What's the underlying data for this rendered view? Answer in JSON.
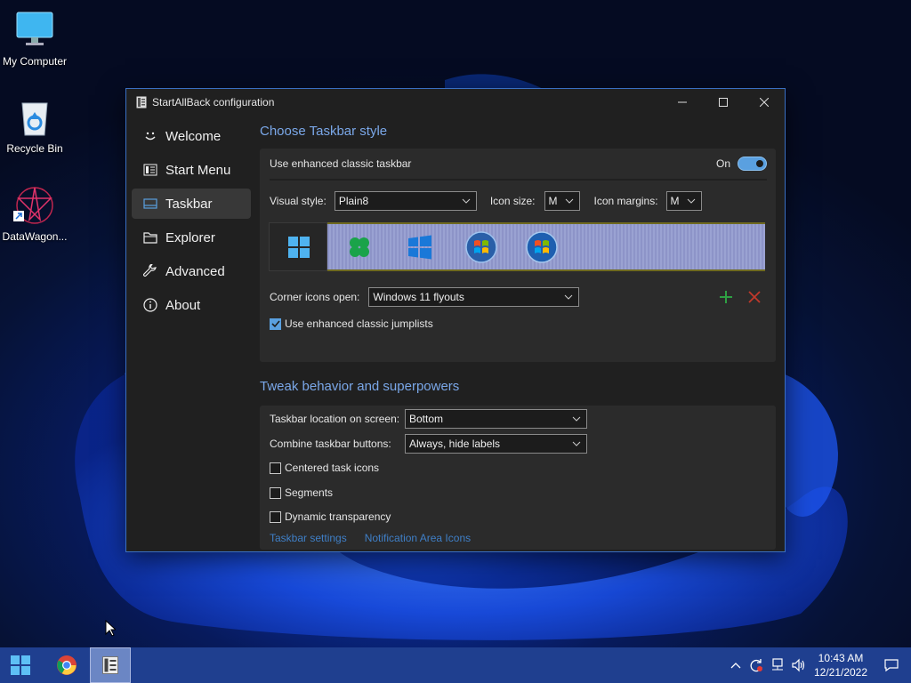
{
  "desktop": {
    "icons": [
      {
        "label": "My Computer",
        "icon": "monitor-icon"
      },
      {
        "label": "Recycle Bin",
        "icon": "recycle-bin-icon"
      },
      {
        "label": "DataWagon...",
        "icon": "datawagon-shortcut-icon"
      }
    ]
  },
  "window": {
    "title": "StartAllBack configuration",
    "controls": [
      "minimize",
      "maximize",
      "close"
    ],
    "sidebar": {
      "items": [
        {
          "label": "Welcome",
          "icon": "smiley-icon",
          "active": false
        },
        {
          "label": "Start Menu",
          "icon": "start-menu-icon",
          "active": false
        },
        {
          "label": "Taskbar",
          "icon": "taskbar-icon",
          "active": true
        },
        {
          "label": "Explorer",
          "icon": "folder-icon",
          "active": false
        },
        {
          "label": "Advanced",
          "icon": "wrench-icon",
          "active": false
        },
        {
          "label": "About",
          "icon": "info-icon",
          "active": false
        }
      ]
    },
    "taskbar_style": {
      "title": "Choose Taskbar style",
      "enhanced_label": "Use enhanced classic taskbar",
      "enhanced_state": "On",
      "visual_style_label": "Visual style:",
      "visual_style_value": "Plain8",
      "icon_size_label": "Icon size:",
      "icon_size_value": "M",
      "icon_margins_label": "Icon margins:",
      "icon_margins_value": "M",
      "preview_icons": [
        "windows-11-start-icon",
        "clover-start-icon",
        "windows-10-start-icon",
        "windows-7-orb-icon",
        "windows-vista-orb-icon"
      ],
      "corner_icons_label": "Corner icons open:",
      "corner_icons_value": "Windows 11 flyouts",
      "jumplists_label": "Use enhanced classic jumplists",
      "jumplists_checked": true
    },
    "tweak": {
      "title": "Tweak behavior and superpowers",
      "location_label": "Taskbar location on screen:",
      "location_value": "Bottom",
      "combine_label": "Combine taskbar buttons:",
      "combine_value": "Always, hide labels",
      "centered_label": "Centered task icons",
      "centered_checked": false,
      "segments_label": "Segments",
      "segments_checked": false,
      "dynamic_label": "Dynamic transparency",
      "dynamic_checked": false,
      "link_taskbar_settings": "Taskbar settings",
      "link_notification": "Notification Area Icons"
    }
  },
  "taskbar": {
    "apps": [
      "start-icon",
      "chrome-icon",
      "startallback-icon"
    ],
    "tray_icons": [
      "chevron-up-icon",
      "sync-icon",
      "network-icon",
      "volume-icon"
    ],
    "time": "10:43 AM",
    "date": "12/21/2022"
  },
  "colors": {
    "accent": "#5aa0e0",
    "section_title": "#7aa7e8",
    "link": "#3f7fc7",
    "window_bg": "#202020",
    "taskbar_bg": "#1f3f8f"
  }
}
